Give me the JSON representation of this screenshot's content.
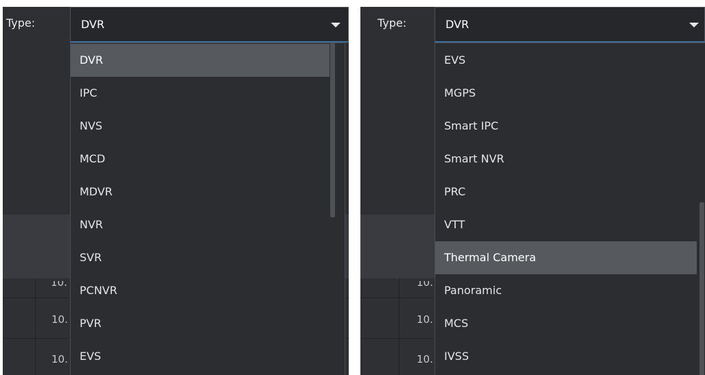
{
  "left_panel": {
    "type_label": "Type:",
    "selected_value": "DVR",
    "options": [
      "DVR",
      "IPC",
      "NVS",
      "MCD",
      "MDVR",
      "NVR",
      "SVR",
      "PCNVR",
      "PVR",
      "EVS"
    ],
    "highlighted_option": "DVR",
    "background_rows": [
      "10.",
      "10.",
      "10."
    ]
  },
  "right_panel": {
    "type_label": "Type:",
    "selected_value": "DVR",
    "options": [
      "EVS",
      "MGPS",
      "Smart IPC",
      "Smart NVR",
      "PRC",
      "VTT",
      "Thermal Camera",
      "Panoramic",
      "MCS",
      "IVSS"
    ],
    "highlighted_option": "Thermal Camera",
    "background_rows": [
      "10.",
      "10.",
      "10."
    ]
  },
  "icons": {
    "dropdown_caret": "caret-down-icon"
  },
  "colors": {
    "panel_bg": "#2b2d31",
    "highlight": "#565a5f",
    "select_border_accent": "#3c6fa0",
    "text": "#e4e6e8"
  }
}
